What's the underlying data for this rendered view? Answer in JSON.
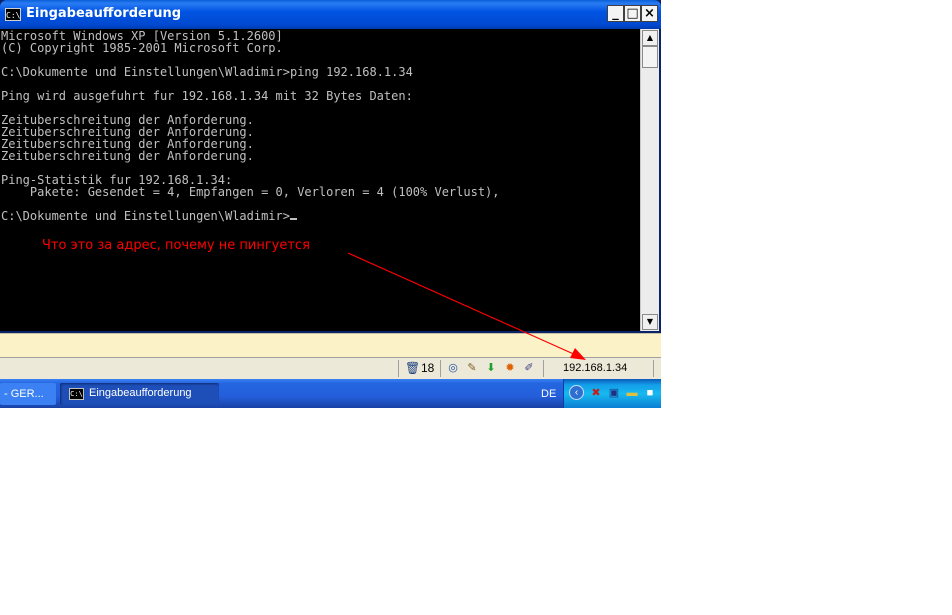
{
  "window": {
    "title": "Eingabeaufforderung",
    "icon_text": "C:\\",
    "minimize_symbol": "_",
    "maximize_symbol": "□",
    "close_symbol": "×"
  },
  "console": {
    "lines": [
      "Microsoft Windows XP [Version 5.1.2600]",
      "(C) Copyright 1985-2001 Microsoft Corp.",
      "",
      "C:\\Dokumente und Einstellungen\\Wladimir>ping 192.168.1.34",
      "",
      "Ping wird ausgefuhrt fur 192.168.1.34 mit 32 Bytes Daten:",
      "",
      "Zeituberschreitung der Anforderung.",
      "Zeituberschreitung der Anforderung.",
      "Zeituberschreitung der Anforderung.",
      "Zeituberschreitung der Anforderung.",
      "",
      "Ping-Statistik fur 192.168.1.34:",
      "    Pakete: Gesendet = 4, Empfangen = 0, Verloren = 4 (100% Verlust),",
      ""
    ],
    "prompt": "C:\\Dokumente und Einstellungen\\Wladimir>"
  },
  "annotation": {
    "text": "Что это за адрес, почему не пингуется",
    "color": "#ff0000"
  },
  "statusbar": {
    "trash_icon": "trash-icon",
    "trash_count": "18",
    "status_icons": [
      "network-icon",
      "brush-icon",
      "download-icon",
      "gear-icon",
      "edit-icon"
    ],
    "ip": "192.168.1.34"
  },
  "taskbar": {
    "prev_task": "- GER...",
    "current_task": "Eingabeaufforderung",
    "language": "DE",
    "tray_icons": [
      "network-tray-icon",
      "monitor-tray-icon",
      "folder-tray-icon",
      "app-tray-icon"
    ]
  },
  "colors": {
    "titlebar": "#0054e3",
    "console_bg": "#000000",
    "console_text": "#c0c0c0",
    "taskbar": "#245edb",
    "tray": "#18b9f0",
    "annotation": "#ff0000"
  }
}
